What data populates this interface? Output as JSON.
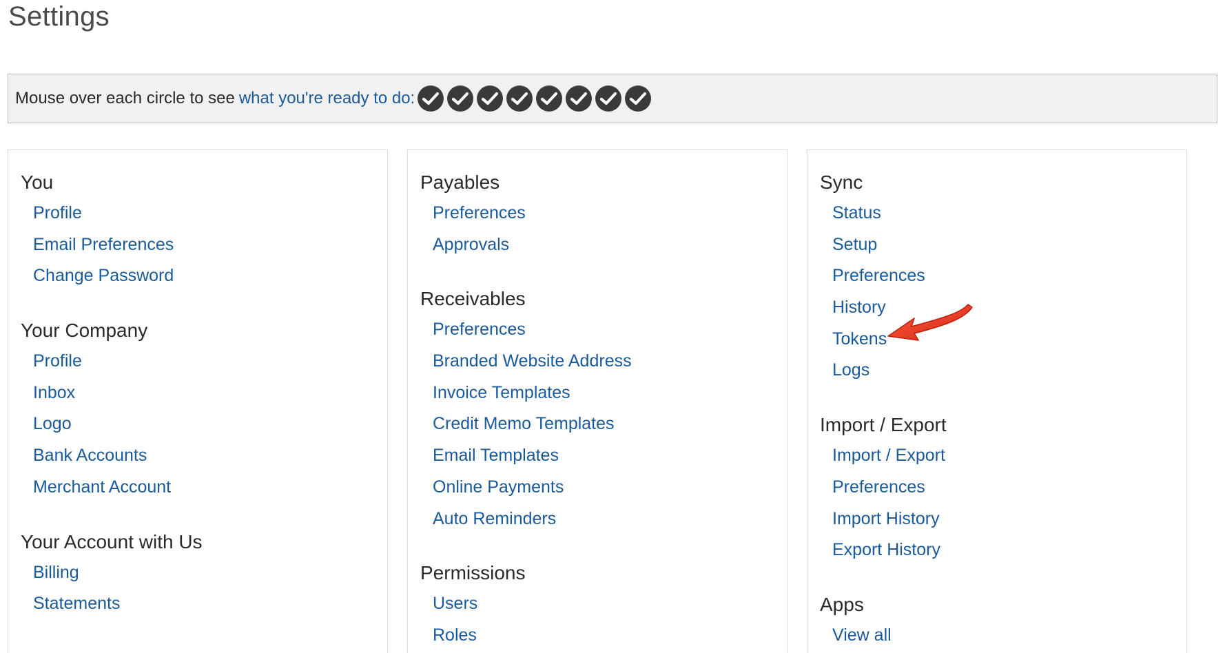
{
  "page": {
    "title": "Settings"
  },
  "status_bar": {
    "prefix": "Mouse over each circle to see",
    "link": "what you're ready to do:",
    "circle_count": 8,
    "circle_icon": "checkmark-icon"
  },
  "columns": [
    {
      "sections": [
        {
          "heading": "You",
          "links": [
            "Profile",
            "Email Preferences",
            "Change Password"
          ]
        },
        {
          "heading": "Your Company",
          "links": [
            "Profile",
            "Inbox",
            "Logo",
            "Bank Accounts",
            "Merchant Account"
          ]
        },
        {
          "heading": "Your Account with Us",
          "links": [
            "Billing",
            "Statements"
          ]
        }
      ]
    },
    {
      "sections": [
        {
          "heading": "Payables",
          "links": [
            "Preferences",
            "Approvals"
          ]
        },
        {
          "heading": "Receivables",
          "links": [
            "Preferences",
            "Branded Website Address",
            "Invoice Templates",
            "Credit Memo Templates",
            "Email Templates",
            "Online Payments",
            "Auto Reminders"
          ]
        },
        {
          "heading": "Permissions",
          "links": [
            "Users",
            "Roles"
          ]
        }
      ]
    },
    {
      "sections": [
        {
          "heading": "Sync",
          "links": [
            "Status",
            "Setup",
            "Preferences",
            "History",
            "Tokens",
            "Logs"
          ]
        },
        {
          "heading": "Import / Export",
          "links": [
            "Import / Export",
            "Preferences",
            "Import History",
            "Export History"
          ]
        },
        {
          "heading": "Apps",
          "links": [
            "View all"
          ]
        }
      ]
    }
  ],
  "colors": {
    "link": "#1a5a9a",
    "heading": "#2a2a2a",
    "status_bar_bg": "#f1f1f1",
    "circle": "#3a3a3a",
    "annotation_arrow": "#e0301e"
  },
  "annotation": {
    "icon": "red-arrow-icon",
    "points_to": "Tokens"
  }
}
